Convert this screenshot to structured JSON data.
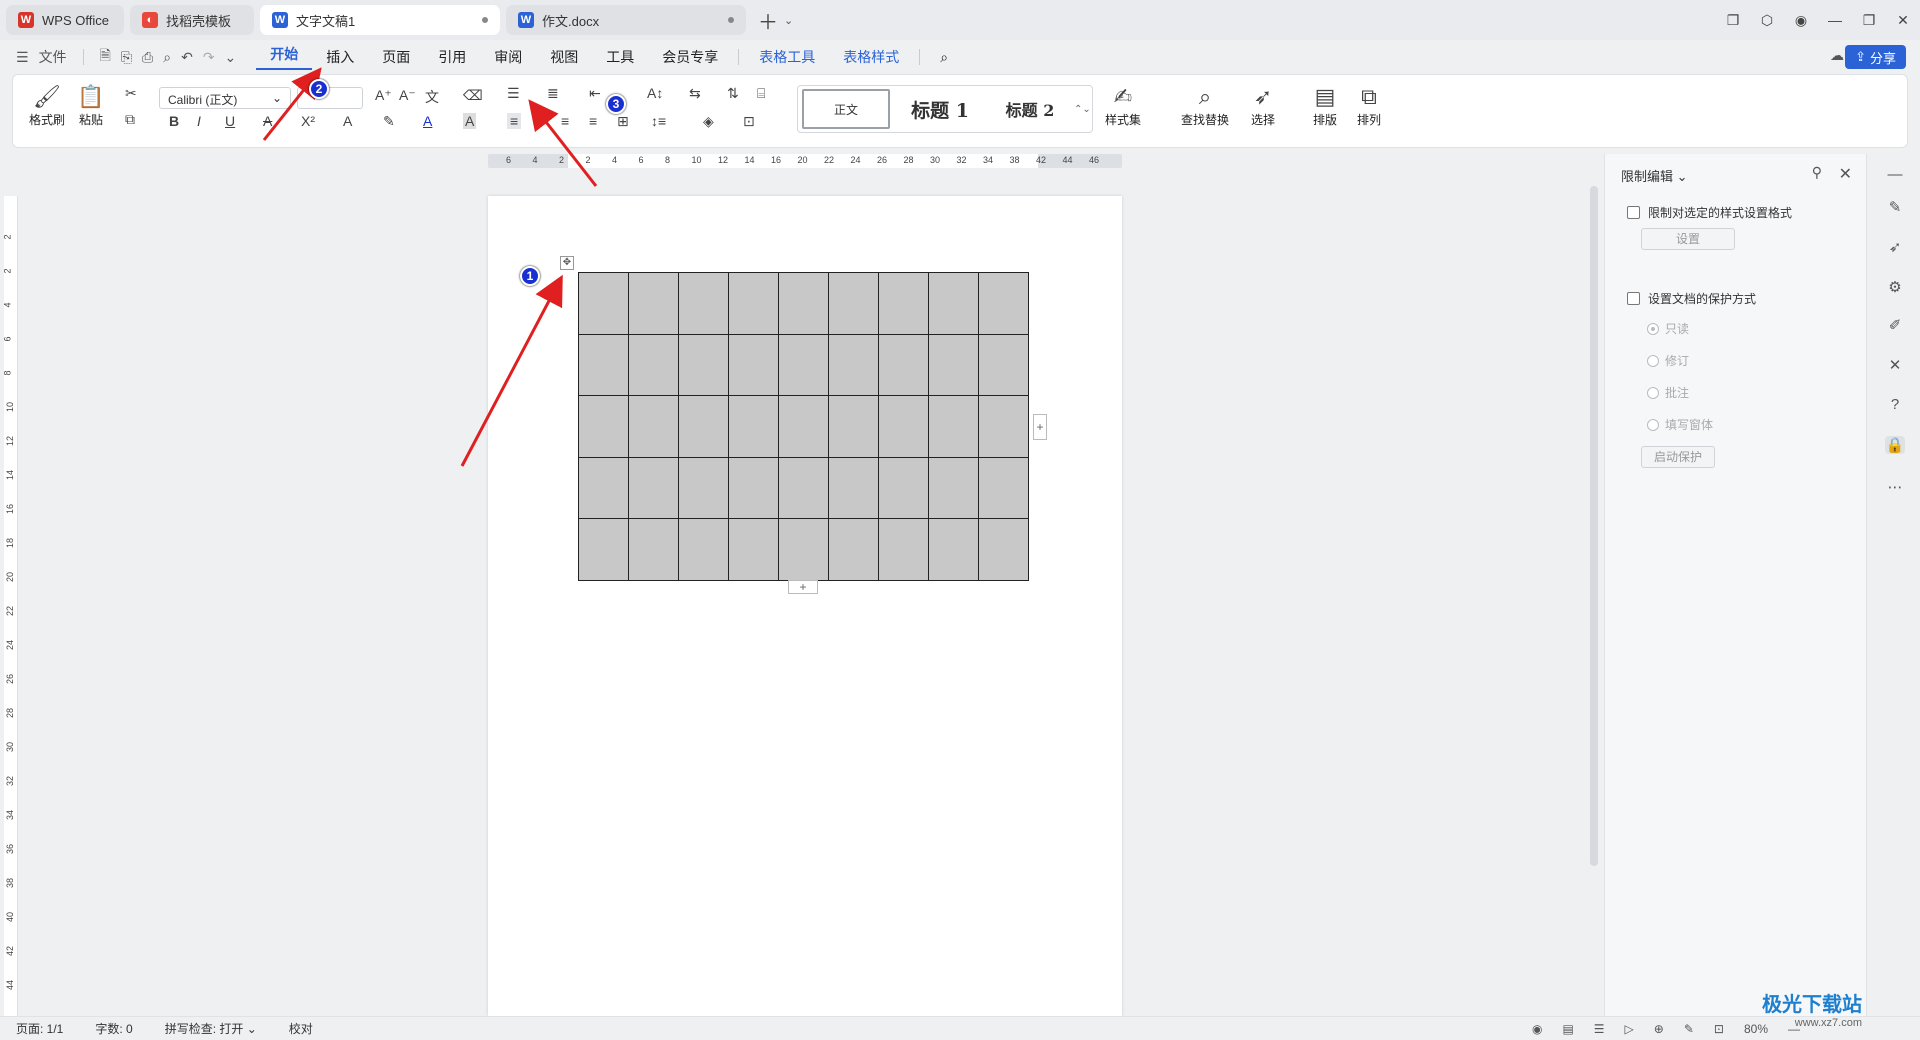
{
  "tabs": [
    {
      "label": "WPS Office",
      "icon": "wps-logo-icon"
    },
    {
      "label": "找稻壳模板",
      "icon": "docer-icon"
    },
    {
      "label": "文字文稿1",
      "icon": "writer-icon"
    },
    {
      "label": "作文.docx",
      "icon": "writer-icon"
    }
  ],
  "menu": {
    "file": "文件",
    "items": [
      "开始",
      "插入",
      "页面",
      "引用",
      "审阅",
      "视图",
      "工具",
      "会员专享"
    ],
    "context_items": [
      "表格工具",
      "表格样式"
    ],
    "share": "分享"
  },
  "ribbon": {
    "format_painter": "格式刷",
    "paste": "粘贴",
    "font_name": "Calibri (正文)",
    "bold": "B",
    "italic": "I",
    "underline": "U",
    "styles": {
      "normal": "正文",
      "h1": "标题 1",
      "h2": "标题 2"
    },
    "style_set": "样式集",
    "find_replace": "查找替换",
    "select": "选择",
    "layout": "排版",
    "arrange": "排列"
  },
  "ruler": {
    "h_ticks": [
      "6",
      "4",
      "2",
      "2",
      "4",
      "6",
      "8",
      "10",
      "12",
      "14",
      "16",
      "20",
      "22",
      "24",
      "26",
      "28",
      "30",
      "32",
      "34",
      "38",
      "42",
      "44",
      "46"
    ],
    "v_ticks": [
      "2",
      "2",
      "4",
      "6",
      "8",
      "10",
      "12",
      "14",
      "16",
      "18",
      "20",
      "22",
      "24",
      "26",
      "28",
      "30",
      "32",
      "34",
      "36",
      "38",
      "40",
      "42",
      "44"
    ]
  },
  "table": {
    "rows": 5,
    "cols": 9
  },
  "restrict_pane": {
    "title": "限制编辑",
    "opt_format": "限制对选定的样式设置格式",
    "settings_btn": "设置",
    "opt_protect": "设置文档的保护方式",
    "modes": [
      "只读",
      "修订",
      "批注",
      "填写窗体"
    ],
    "start_btn": "启动保护"
  },
  "status": {
    "page": "页面: 1/1",
    "words": "字数: 0",
    "spell": "拼写检查: 打开",
    "proof": "校对",
    "zoom": "80%"
  },
  "annotations": [
    "1",
    "2",
    "3"
  ],
  "watermark": {
    "title": "极光下载站",
    "sub": "www.xz7.com"
  },
  "colors": {
    "accent": "#2b62d6",
    "arrow": "#e02020",
    "badge": "#1a2fd1"
  }
}
